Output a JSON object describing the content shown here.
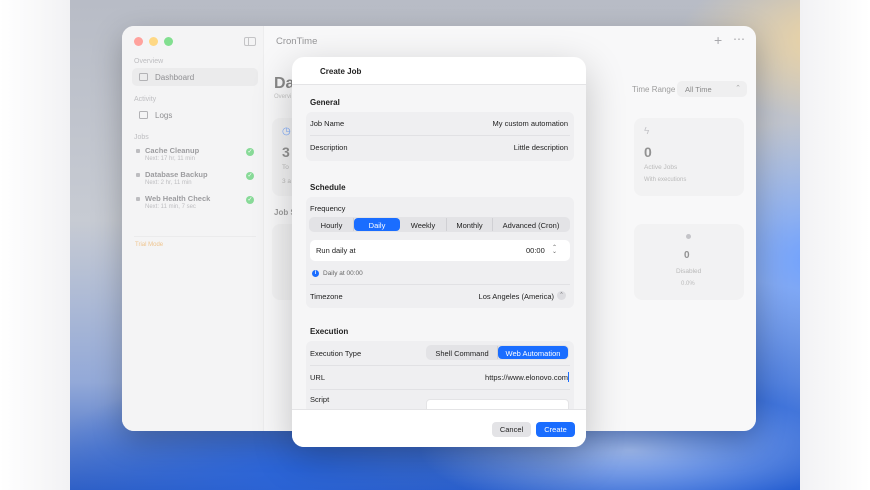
{
  "app": {
    "title": "CronTime",
    "toolbar": {
      "add_icon": "plus-icon",
      "more_icon": "ellipsis-icon"
    }
  },
  "sidebar": {
    "sections": {
      "overview": "Overview",
      "activity": "Activity",
      "jobs": "Jobs"
    },
    "items": [
      {
        "label": "Dashboard",
        "icon": "chart-icon",
        "active": true
      },
      {
        "label": "Logs",
        "icon": "list-icon",
        "active": false
      }
    ],
    "jobs": [
      {
        "name": "Cache Cleanup",
        "next": "Next: 17 hr, 11 min"
      },
      {
        "name": "Database Backup",
        "next": "Next: 2 hr, 11 min"
      },
      {
        "name": "Web Health Check",
        "next": "Next: 11 min, 7 sec"
      }
    ],
    "trial": "Trial Mode"
  },
  "dashboard": {
    "title": "Da",
    "subtitle": "Overvi",
    "time_range_label": "Time Range",
    "time_range_value": "All Time",
    "section_title": "Job S",
    "cards": [
      {
        "num": "3",
        "label": "To"
      },
      {
        "num": "0",
        "label": "Active Jobs",
        "sub": "With executions"
      },
      {
        "num": "0",
        "label": "Disabled",
        "sub": "0.0%"
      }
    ],
    "card_misc": {
      "left_fragment": "3 a"
    }
  },
  "modal": {
    "title": "Create Job",
    "general": {
      "heading": "General",
      "job_name_label": "Job Name",
      "job_name_value": "My custom automation",
      "description_label": "Description",
      "description_value": "Little description"
    },
    "schedule": {
      "heading": "Schedule",
      "frequency_label": "Frequency",
      "frequency_options": [
        "Hourly",
        "Daily",
        "Weekly",
        "Monthly",
        "Advanced (Cron)"
      ],
      "frequency_selected": "Daily",
      "run_label": "Run daily at",
      "run_time": "00:00",
      "info_text": "Daily at 00:00",
      "timezone_label": "Timezone",
      "timezone_value": "Los Angeles (America)"
    },
    "execution": {
      "heading": "Execution",
      "type_label": "Execution Type",
      "type_options": [
        "Shell Command",
        "Web Automation"
      ],
      "type_selected": "Web Automation",
      "url_label": "URL",
      "url_value": "https://www.elonovo.com",
      "script_label": "Script"
    },
    "buttons": {
      "cancel": "Cancel",
      "create": "Create"
    }
  },
  "colors": {
    "accent": "#1a6dff",
    "success": "#33c04e",
    "trial": "#e39a3b"
  }
}
